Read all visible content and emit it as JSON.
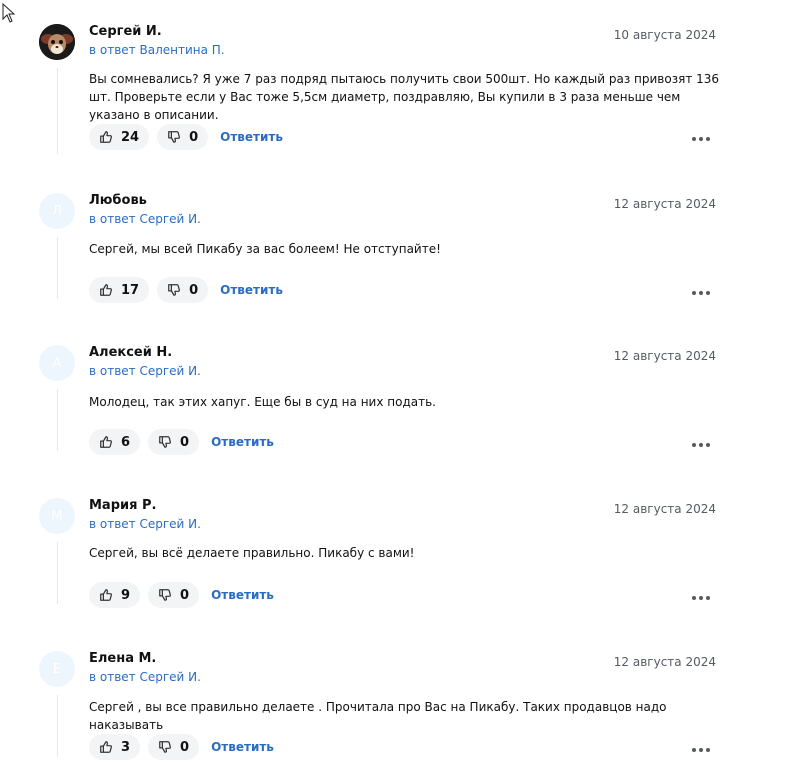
{
  "comments": [
    {
      "author": "Сергей И.",
      "reply_to": "в ответ Валентина П.",
      "date": "10 августа 2024",
      "text": "Вы сомневались? Я уже 7 раз подряд пытаюсь получить свои 500шт. Но каждый раз привозят 136 шт. Проверьте если у Вас тоже 5,5см диаметр, поздравляю, Вы купили в 3 раза меньше чем указано в описании.",
      "likes": "24",
      "dislikes": "0",
      "reply_label": "Ответить",
      "avatar_letter": ""
    },
    {
      "author": "Любовь",
      "reply_to": "в ответ Сергей И.",
      "date": "12 августа 2024",
      "text": "Сергей, мы всей Пикабу за вас болеем! Не отступайте!",
      "likes": "17",
      "dislikes": "0",
      "reply_label": "Ответить",
      "avatar_letter": "Л"
    },
    {
      "author": "Алексей Н.",
      "reply_to": "в ответ Сергей И.",
      "date": "12 августа 2024",
      "text": "Молодец, так этих хапуг. Еще бы в суд на них подать.",
      "likes": "6",
      "dislikes": "0",
      "reply_label": "Ответить",
      "avatar_letter": "А"
    },
    {
      "author": "Мария Р.",
      "reply_to": "в ответ Сергей И.",
      "date": "12 августа 2024",
      "text": "Сергей, вы всё делаете правильно. Пикабу с вами!",
      "likes": "9",
      "dislikes": "0",
      "reply_label": "Ответить",
      "avatar_letter": "М"
    },
    {
      "author": "Елена М.",
      "reply_to": "в ответ Сергей И.",
      "date": "12 августа 2024",
      "text": "Сергей , вы все правильно делаете . Прочитала про Вас на Пикабу. Таких продавцов надо наказывать",
      "likes": "3",
      "dislikes": "0",
      "reply_label": "Ответить",
      "avatar_letter": "Е"
    }
  ],
  "colors": {
    "link": "#2b6cc2",
    "avatar_bg": "#eef6fd",
    "vote_bg": "#f3f4f6",
    "muted": "#555b63"
  },
  "icons": {
    "like": "thumbs-up-icon",
    "dislike": "thumbs-down-icon",
    "more": "more-horizontal-icon",
    "cursor": "mouse-pointer-icon"
  }
}
